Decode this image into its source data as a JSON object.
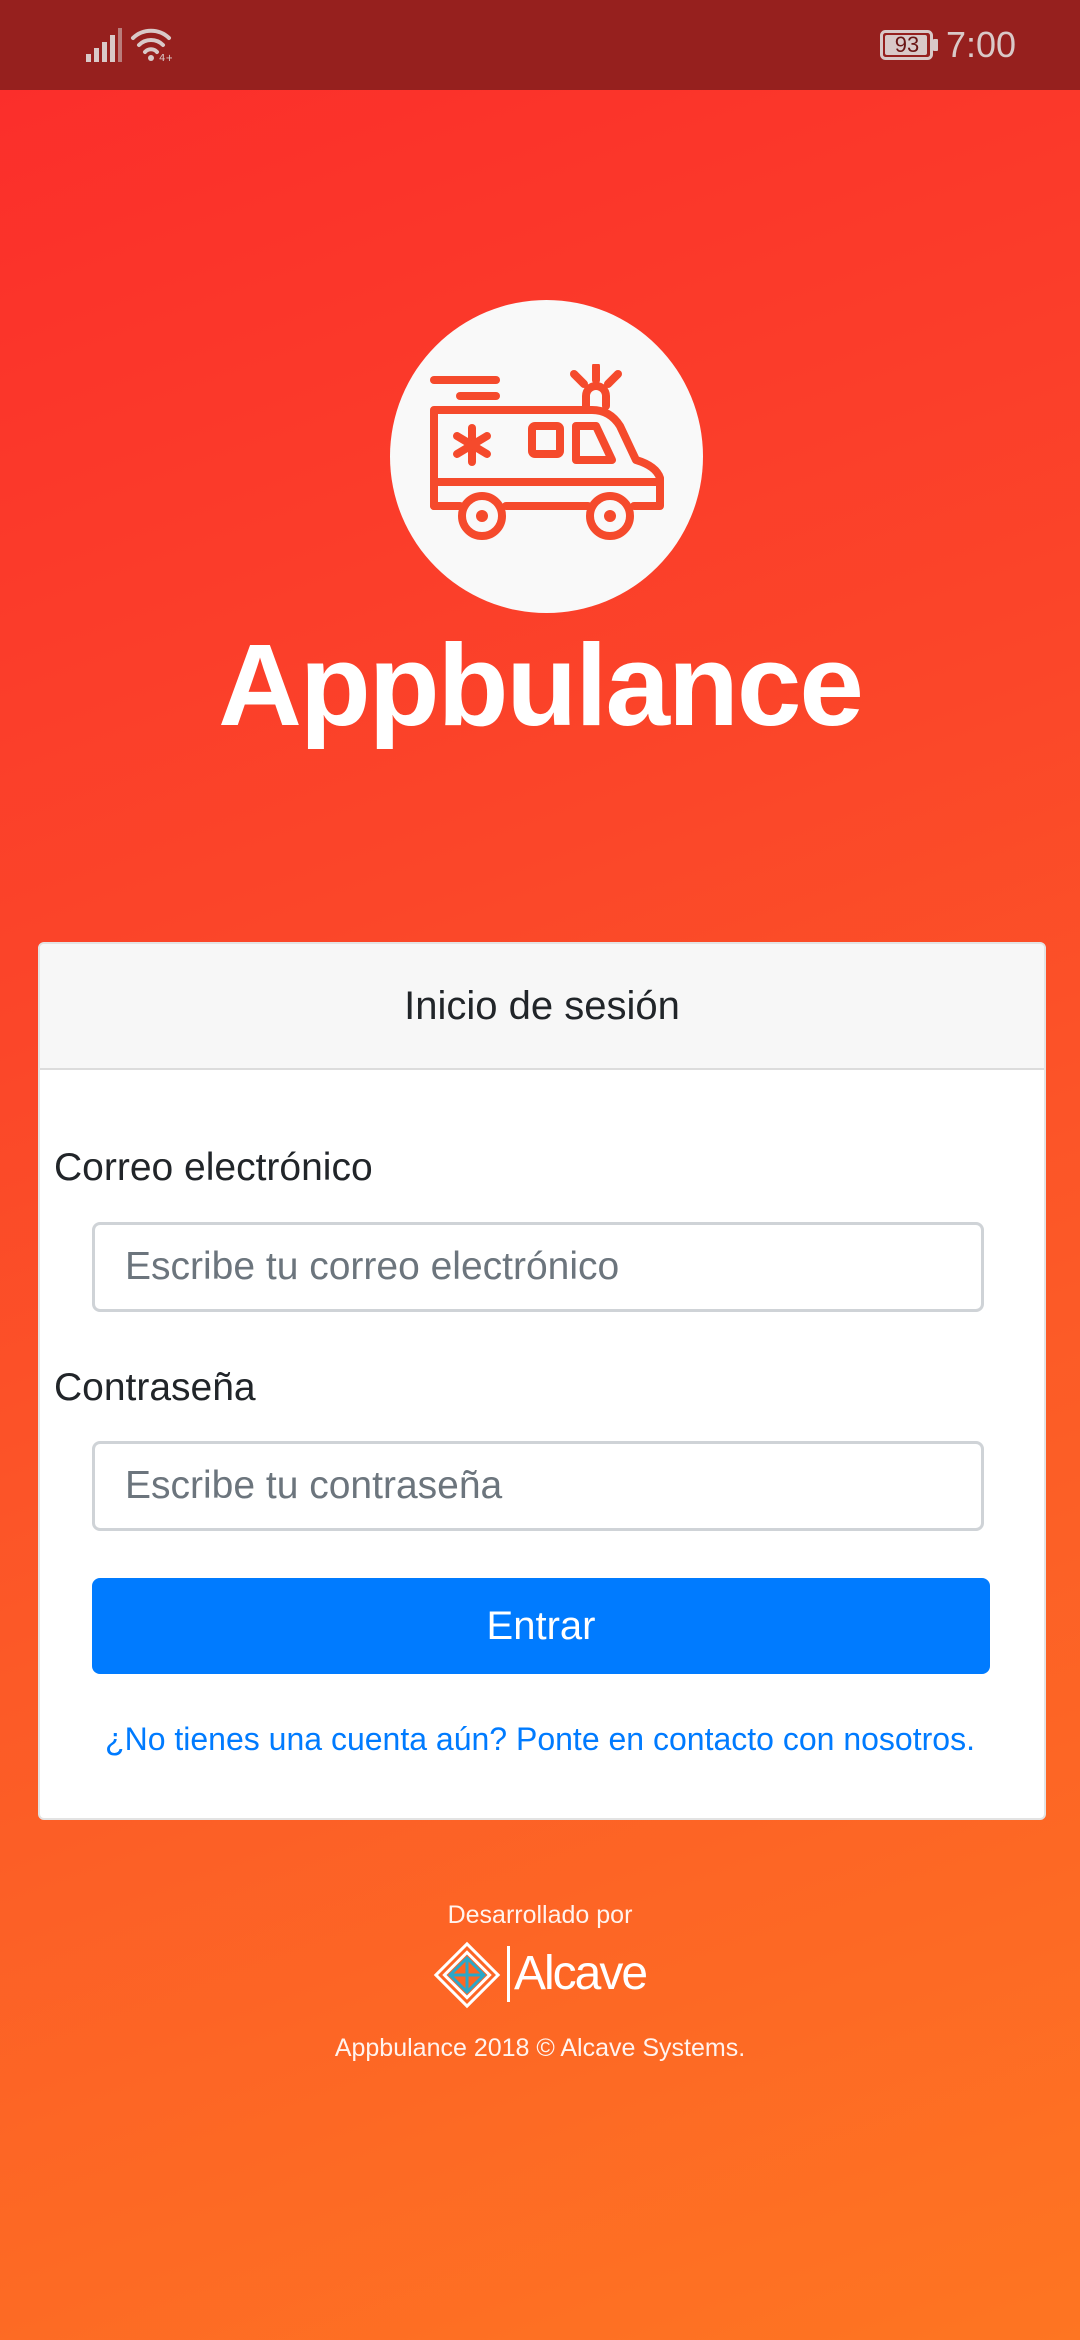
{
  "status_bar": {
    "battery": "93",
    "time": "7:00",
    "icons": [
      "signal-icon",
      "wifi-icon",
      "battery-icon"
    ]
  },
  "logo": {
    "icon": "ambulance-icon",
    "app_name": "Appbulance"
  },
  "login_card": {
    "title": "Inicio de sesión",
    "email": {
      "label": "Correo electrónico",
      "placeholder": "Escribe tu correo electrónico",
      "value": ""
    },
    "password": {
      "label": "Contraseña",
      "placeholder": "Escribe tu contraseña",
      "value": ""
    },
    "submit_label": "Entrar",
    "contact_link": "¿No tienes una cuenta aún? Ponte en contacto con nosotros."
  },
  "footer": {
    "developed_by": "Desarrollado por",
    "company_logo": "alcave-logo-icon",
    "company_name": "Alcave",
    "copyright": "Appbulance 2018 © Alcave Systems."
  },
  "colors": {
    "status_bar": "#96201e",
    "gradient_start": "#fb2c2b",
    "gradient_end": "#fe7522",
    "accent": "#007bff",
    "icon_red": "#f54a2c"
  }
}
